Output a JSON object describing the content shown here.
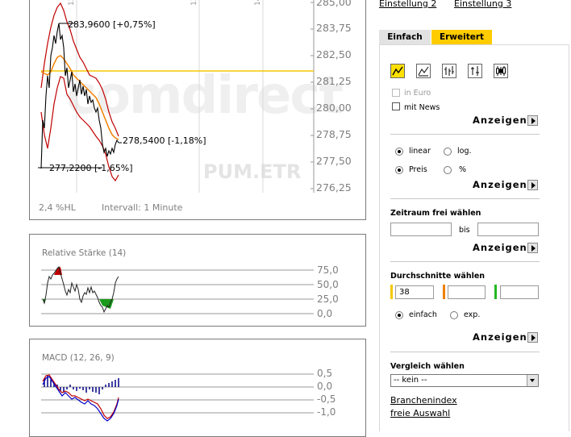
{
  "header": {
    "einstellung2": "Einstellung 2",
    "einstellung3": "Einstellung 3"
  },
  "tabs": [
    {
      "label": "Einfach",
      "active": false
    },
    {
      "label": "Erweitert",
      "active": true
    }
  ],
  "main_chart": {
    "y_labels": [
      "285,00",
      "283,75",
      "282,50",
      "281,25",
      "280,00",
      "278,75",
      "277,50",
      "276,25"
    ],
    "annotation_high": "283,9600 [+0,75%]",
    "annotation_last": "278,5400 [-1,18%]",
    "annotation_low": "277,2200 [-1,65%]",
    "watermark": "comdirect",
    "symbol": "PUM.ETR",
    "hl_text": "2,4 %HL",
    "interval_text": "Intervall: 1 Minute",
    "colors": {
      "price": "#000000",
      "band": "#c00000",
      "avg": "#f08000",
      "ref": "#f5c800"
    }
  },
  "rsi_chart": {
    "title": "Relative Stärke (14)",
    "y_labels": [
      "75,0",
      "50,0",
      "25,0",
      "0,0"
    ]
  },
  "macd_chart": {
    "title": "MACD (12, 26, 9)",
    "y_labels": [
      "0,5",
      "0,0",
      "-0,5",
      "-1,0"
    ]
  },
  "chart_types": [
    "line-chart-icon",
    "mountain-chart-icon",
    "ohlc-chart-icon",
    "bar-chart-icon",
    "candlestick-chart-icon"
  ],
  "options": {
    "in_euro": "in Euro",
    "mit_news": "mit News",
    "anzeigen": "Anzeigen",
    "linear": "linear",
    "log": "log.",
    "preis": "Preis",
    "percent": "%"
  },
  "zeitraum": {
    "title": "Zeitraum frei wählen",
    "bis": "bis",
    "from_value": "",
    "to_value": ""
  },
  "durchschnitte": {
    "title": "Durchschnitte wählen",
    "values": [
      "38",
      "",
      ""
    ],
    "colors": [
      "#f5c800",
      "#f08000",
      "#22b822"
    ],
    "einfach": "einfach",
    "exp": "exp."
  },
  "vergleich": {
    "title": "Vergleich wählen",
    "selected": "-- kein --",
    "branchenindex": "Branchenindex",
    "freie_auswahl": "freie Auswahl"
  }
}
